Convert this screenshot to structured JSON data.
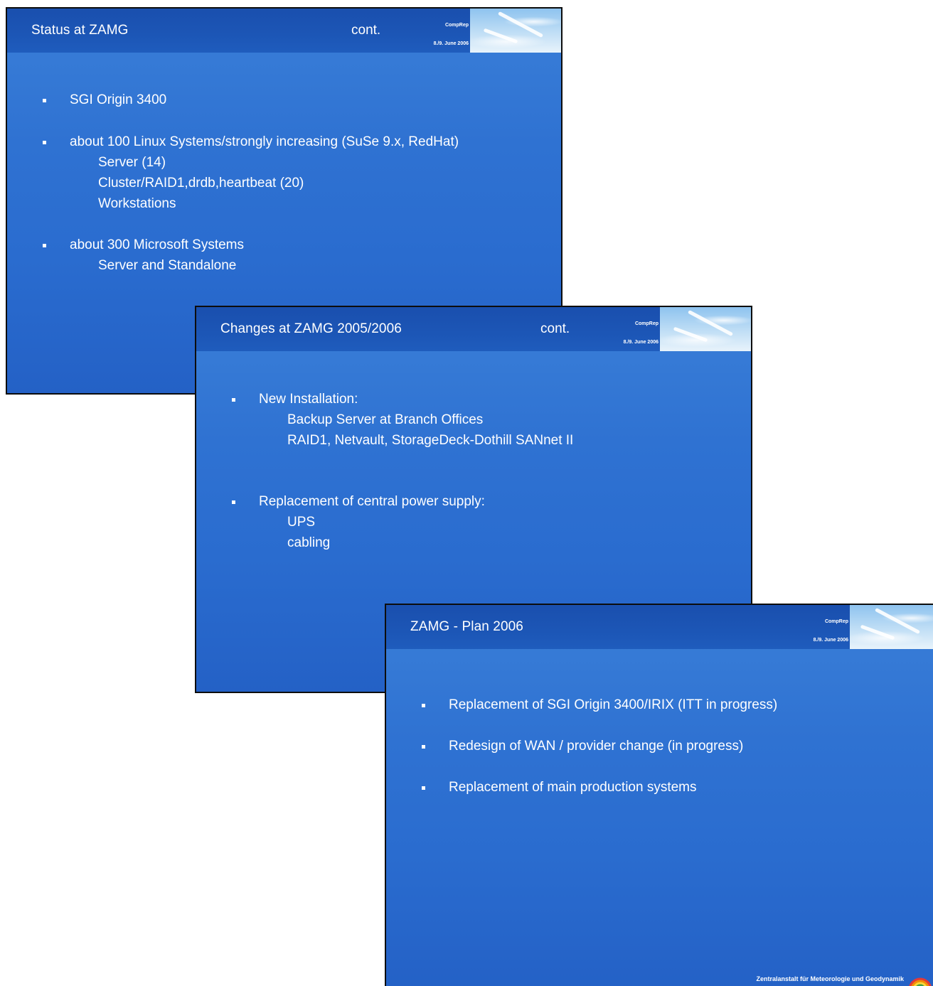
{
  "conference": {
    "name": "CompRep",
    "date": "8./9. June 2006"
  },
  "slides": [
    {
      "title": "Status at ZAMG",
      "cont": "cont.",
      "bullets": [
        {
          "text": "SGI Origin 3400",
          "sub": []
        },
        {
          "text": "about 100 Linux Systems/strongly increasing  (SuSe 9.x, RedHat)",
          "sub": [
            "Server  (14)",
            "Cluster/RAID1,drdb,heartbeat  (20)",
            "Workstations"
          ]
        },
        {
          "text": "about 300 Microsoft Systems",
          "sub": [
            "Server and Standalone"
          ]
        }
      ]
    },
    {
      "title": "Changes at ZAMG 2005/2006",
      "cont": "cont.",
      "bullets": [
        {
          "text": "New Installation:",
          "sub": [
            "Backup Server at Branch Offices",
            "RAID1, Netvault, StorageDeck-Dothill SANnet II"
          ]
        },
        {
          "text": "Replacement of central power supply:",
          "sub": [
            "UPS",
            "cabling"
          ]
        }
      ]
    },
    {
      "title": "ZAMG - Plan 2006",
      "cont": "",
      "bullets": [
        {
          "text": "Replacement of SGI Origin 3400/IRIX  (ITT in progress)",
          "sub": []
        },
        {
          "text": "Redesign of  WAN / provider change  (in progress)",
          "sub": []
        },
        {
          "text": "Replacement of main production systems",
          "sub": []
        }
      ],
      "footer": "Zentralanstalt für Meteorologie und Geodynamik"
    }
  ]
}
